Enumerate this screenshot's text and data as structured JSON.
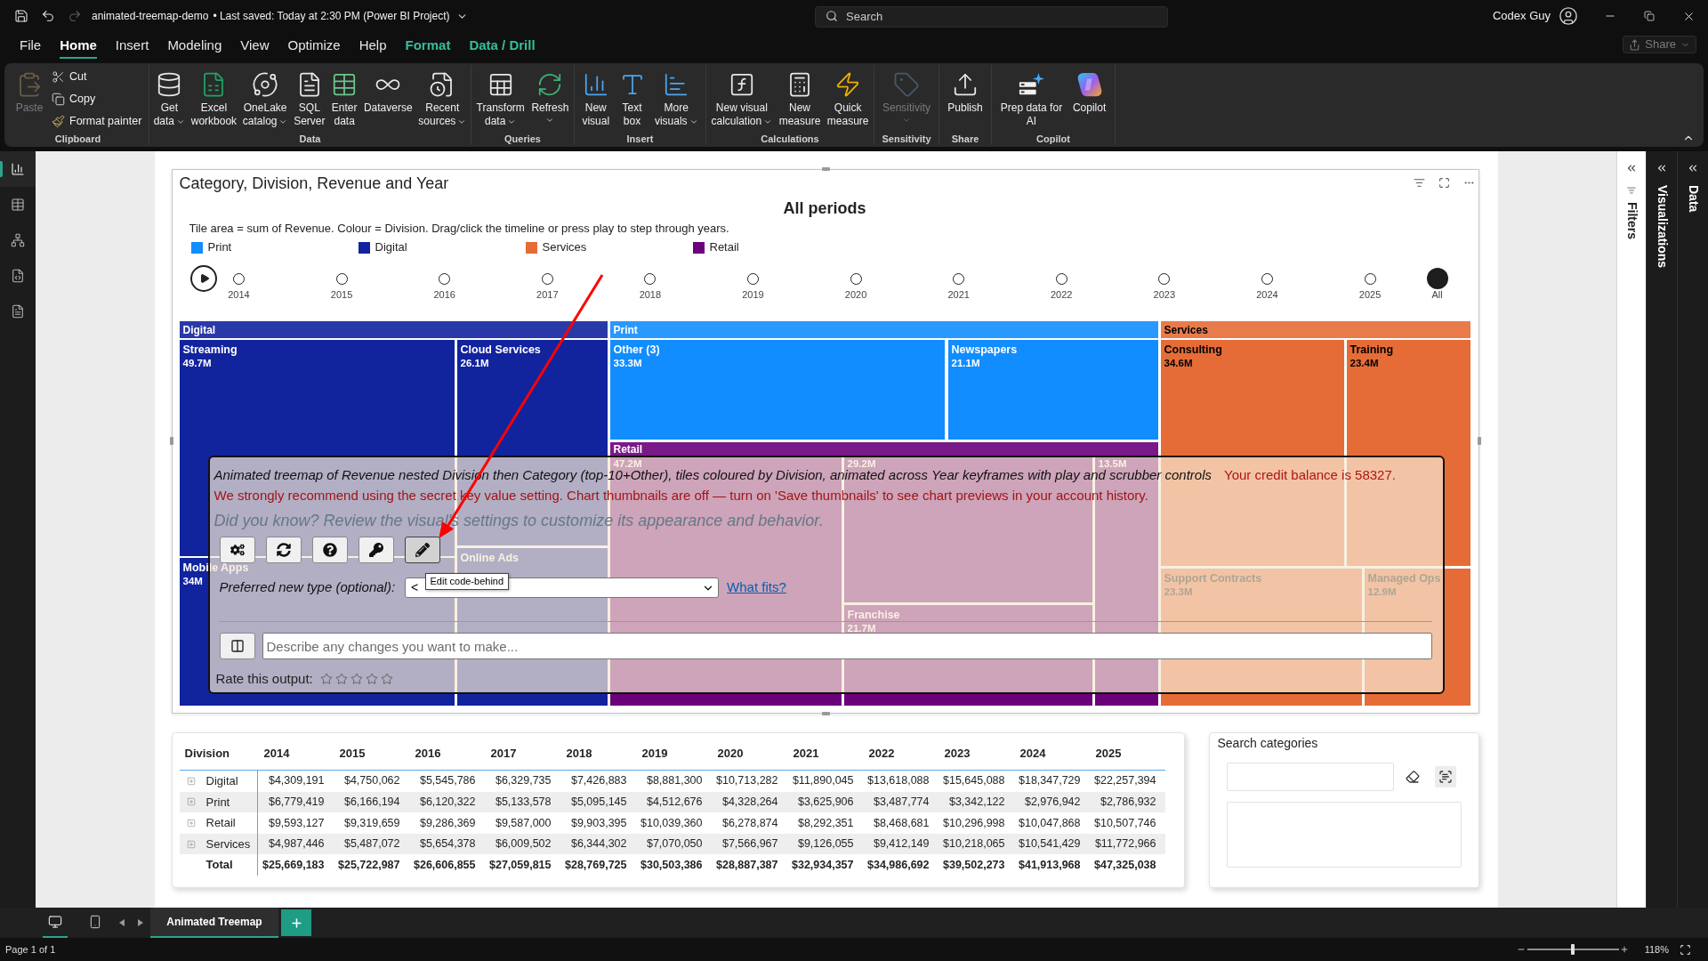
{
  "title_bar": {
    "document_title": "animated-treemap-demo",
    "save_status": "• Last saved: Today at 2:30 PM (Power BI Project)",
    "redo_disabled": true,
    "search": {
      "placeholder": "Search"
    },
    "user_name": "Codex Guy"
  },
  "menu": {
    "tabs": [
      {
        "label": "File",
        "selected": false,
        "kind": "standard"
      },
      {
        "label": "Home",
        "selected": true,
        "kind": "standard"
      },
      {
        "label": "Insert",
        "selected": false,
        "kind": "standard"
      },
      {
        "label": "Modeling",
        "selected": false,
        "kind": "standard"
      },
      {
        "label": "View",
        "selected": false,
        "kind": "standard"
      },
      {
        "label": "Optimize",
        "selected": false,
        "kind": "standard"
      },
      {
        "label": "Help",
        "selected": false,
        "kind": "standard"
      },
      {
        "label": "Format",
        "selected": false,
        "kind": "contextual"
      },
      {
        "label": "Data / Drill",
        "selected": false,
        "kind": "contextual"
      }
    ],
    "share": {
      "label": "Share",
      "disabled": true
    }
  },
  "ribbon": {
    "groups": [
      {
        "label": "Clipboard",
        "items": [
          {
            "label": "Paste",
            "kind": "large",
            "disabled": true,
            "dropdown": false
          },
          {
            "label": "Cut",
            "kind": "small",
            "disabled": false,
            "dropdown": false
          },
          {
            "label": "Copy",
            "kind": "small",
            "disabled": false,
            "dropdown": false
          },
          {
            "label": "Format painter",
            "kind": "small",
            "disabled": false,
            "dropdown": false
          }
        ]
      },
      {
        "label": "Data",
        "items": [
          {
            "label": "Get\ndata",
            "kind": "large",
            "disabled": false,
            "dropdown": true
          },
          {
            "label": "Excel\nworkbook",
            "kind": "large",
            "disabled": false,
            "dropdown": false
          },
          {
            "label": "OneLake\ncatalog",
            "kind": "large",
            "disabled": false,
            "dropdown": true
          },
          {
            "label": "SQL\nServer",
            "kind": "large",
            "disabled": false,
            "dropdown": false
          },
          {
            "label": "Enter\ndata",
            "kind": "large",
            "disabled": false,
            "dropdown": false
          },
          {
            "label": "Dataverse",
            "kind": "large",
            "disabled": false,
            "dropdown": false
          },
          {
            "label": "Recent\nsources",
            "kind": "large",
            "disabled": false,
            "dropdown": true
          }
        ]
      },
      {
        "label": "Queries",
        "items": [
          {
            "label": "Transform\ndata",
            "kind": "large",
            "disabled": false,
            "dropdown": true
          },
          {
            "label": "Refresh",
            "kind": "large",
            "disabled": false,
            "dropdown": true
          }
        ]
      },
      {
        "label": "Insert",
        "items": [
          {
            "label": "New\nvisual",
            "kind": "large",
            "disabled": false,
            "dropdown": false
          },
          {
            "label": "Text\nbox",
            "kind": "large",
            "disabled": false,
            "dropdown": false
          },
          {
            "label": "More\nvisuals",
            "kind": "large",
            "disabled": false,
            "dropdown": true
          }
        ]
      },
      {
        "label": "Calculations",
        "items": [
          {
            "label": "New visual\ncalculation",
            "kind": "large",
            "disabled": false,
            "dropdown": true
          },
          {
            "label": "New\nmeasure",
            "kind": "large",
            "disabled": false,
            "dropdown": false
          },
          {
            "label": "Quick\nmeasure",
            "kind": "large",
            "disabled": false,
            "dropdown": false
          }
        ]
      },
      {
        "label": "Sensitivity",
        "items": [
          {
            "label": "Sensitivity",
            "kind": "large",
            "disabled": true,
            "dropdown": true
          }
        ]
      },
      {
        "label": "Share",
        "items": [
          {
            "label": "Publish",
            "kind": "large",
            "disabled": false,
            "dropdown": false
          }
        ]
      },
      {
        "label": "Copilot",
        "items": [
          {
            "label": "Prep data for\nAI",
            "kind": "large",
            "disabled": false,
            "dropdown": false
          },
          {
            "label": "Copilot",
            "kind": "large",
            "disabled": false,
            "dropdown": false
          }
        ]
      }
    ]
  },
  "view_switcher": [
    {
      "selected": true
    },
    {
      "selected": false
    },
    {
      "selected": false
    },
    {
      "selected": false
    },
    {
      "selected": false
    }
  ],
  "report": {
    "visual": {
      "title": "Category, Division, Revenue and Year",
      "heading": "All periods",
      "caption": "Tile area = sum of Revenue. Colour = Division. Drag/click the timeline or press play to step through years.",
      "legend": [
        {
          "label": "Print",
          "color": "#118dff"
        },
        {
          "label": "Digital",
          "color": "#12239e"
        },
        {
          "label": "Services",
          "color": "#e66c37"
        },
        {
          "label": "Retail",
          "color": "#6b007b"
        }
      ],
      "timeline": {
        "playing": false,
        "stops": [
          {
            "label": "2014",
            "selected": false
          },
          {
            "label": "2015",
            "selected": false
          },
          {
            "label": "2016",
            "selected": false
          },
          {
            "label": "2017",
            "selected": false
          },
          {
            "label": "2018",
            "selected": false
          },
          {
            "label": "2019",
            "selected": false
          },
          {
            "label": "2020",
            "selected": false
          },
          {
            "label": "2021",
            "selected": false
          },
          {
            "label": "2022",
            "selected": false
          },
          {
            "label": "2023",
            "selected": false
          },
          {
            "label": "2024",
            "selected": false
          },
          {
            "label": "2025",
            "selected": false
          },
          {
            "label": "All",
            "selected": true
          }
        ]
      },
      "treemap": {
        "groups": [
          {
            "label": "Digital",
            "color": "#12239e",
            "tiles": [
              {
                "label": "Streaming",
                "value": "49.7M"
              },
              {
                "label": "Cloud Services",
                "value": "26.1M"
              },
              {
                "label": "Online Ads"
              },
              {
                "label": "Mobile Apps",
                "value": "34M"
              }
            ]
          },
          {
            "label": "Print",
            "color": "#118dff",
            "tiles": [
              {
                "label": "Other (3)",
                "value": "33.3M"
              },
              {
                "label": "Newspapers",
                "value": "21.1M"
              }
            ]
          },
          {
            "label": "Retail",
            "color": "#6b007b",
            "tiles": [
              {
                "value": "47.2M"
              },
              {
                "value": "29.2M"
              },
              {
                "value": "13.5M"
              },
              {
                "label": "Franchise",
                "value": "21.7M"
              }
            ]
          },
          {
            "label": "Services",
            "color": "#e66c37",
            "tiles": [
              {
                "label": "Consulting",
                "value": "34.6M"
              },
              {
                "label": "Training",
                "value": "23.4M"
              },
              {
                "label": "Support Contracts",
                "value": "23.3M"
              },
              {
                "label": "Managed Ops",
                "value": "12.9M"
              }
            ]
          }
        ]
      },
      "dialog": {
        "summary": "Animated treemap of Revenue nested Division then Category (top-10+Other), tiles coloured by Division, animated across Year keyframes with play and scrubber controls",
        "credit_notice": "Your credit balance is 58327.",
        "warning": "We strongly recommend using the secret key value setting. Chart thumbnails are off — turn on 'Save thumbnails' to see chart previews in your account history.",
        "tip": "Did you know? Review the visual's settings to customize its appearance and behavior.",
        "tool_buttons": [
          {
            "hovered": false
          },
          {
            "hovered": false
          },
          {
            "hovered": false
          },
          {
            "hovered": false
          },
          {
            "hovered": true,
            "tooltip": "Edit code-behind"
          }
        ],
        "type_picker": {
          "label": "Preferred new type (optional):",
          "value": "<",
          "help_link": "What fits?"
        },
        "prompt": {
          "placeholder": "Describe any changes you want to make..."
        },
        "rating": {
          "label": "Rate this output:",
          "stars": 0
        }
      }
    },
    "matrix": {
      "columns": [
        "Division",
        "2014",
        "2015",
        "2016",
        "2017",
        "2018",
        "2019",
        "2020",
        "2021",
        "2022",
        "2023",
        "2024",
        "2025"
      ],
      "rows": [
        {
          "label": "Digital",
          "expanded": false,
          "values": [
            "$4,309,191",
            "$4,750,062",
            "$5,545,786",
            "$6,329,735",
            "$7,426,883",
            "$8,881,300",
            "$10,713,282",
            "$11,890,045",
            "$13,618,088",
            "$15,645,088",
            "$18,347,729",
            "$22,257,394"
          ]
        },
        {
          "label": "Print",
          "expanded": false,
          "values": [
            "$6,779,419",
            "$6,166,194",
            "$6,120,322",
            "$5,133,578",
            "$5,095,145",
            "$4,512,676",
            "$4,328,264",
            "$3,625,906",
            "$3,487,774",
            "$3,342,122",
            "$2,976,942",
            "$2,786,932"
          ]
        },
        {
          "label": "Retail",
          "expanded": false,
          "values": [
            "$9,593,127",
            "$9,319,659",
            "$9,286,369",
            "$9,587,000",
            "$9,903,395",
            "$10,039,360",
            "$6,278,874",
            "$8,292,351",
            "$8,468,681",
            "$10,296,998",
            "$10,047,868",
            "$10,507,746"
          ]
        },
        {
          "label": "Services",
          "expanded": false,
          "values": [
            "$4,987,446",
            "$5,487,072",
            "$5,654,378",
            "$6,009,502",
            "$6,344,302",
            "$7,070,050",
            "$7,566,967",
            "$9,126,055",
            "$9,412,149",
            "$10,218,065",
            "$10,541,429",
            "$11,772,966"
          ]
        }
      ],
      "total": {
        "label": "Total",
        "values": [
          "$25,669,183",
          "$25,722,987",
          "$26,606,855",
          "$27,059,815",
          "$28,769,725",
          "$30,503,386",
          "$28,887,387",
          "$32,934,357",
          "$34,986,692",
          "$39,502,273",
          "$41,913,968",
          "$47,325,038"
        ]
      }
    },
    "slicer": {
      "title": "Search categories"
    }
  },
  "panes": [
    {
      "label": "Filters",
      "kind": "light"
    },
    {
      "label": "Visualizations",
      "kind": "dark"
    },
    {
      "label": "Data",
      "kind": "dark"
    }
  ],
  "page_bar": {
    "layouts": [
      {
        "selected": true
      },
      {
        "selected": false
      }
    ],
    "tabs": [
      {
        "label": "Animated Treemap",
        "selected": true
      }
    ]
  },
  "status_bar": {
    "page_info": "Page 1 of 1",
    "zoom": {
      "level": 0.5,
      "reading": "118%"
    }
  }
}
